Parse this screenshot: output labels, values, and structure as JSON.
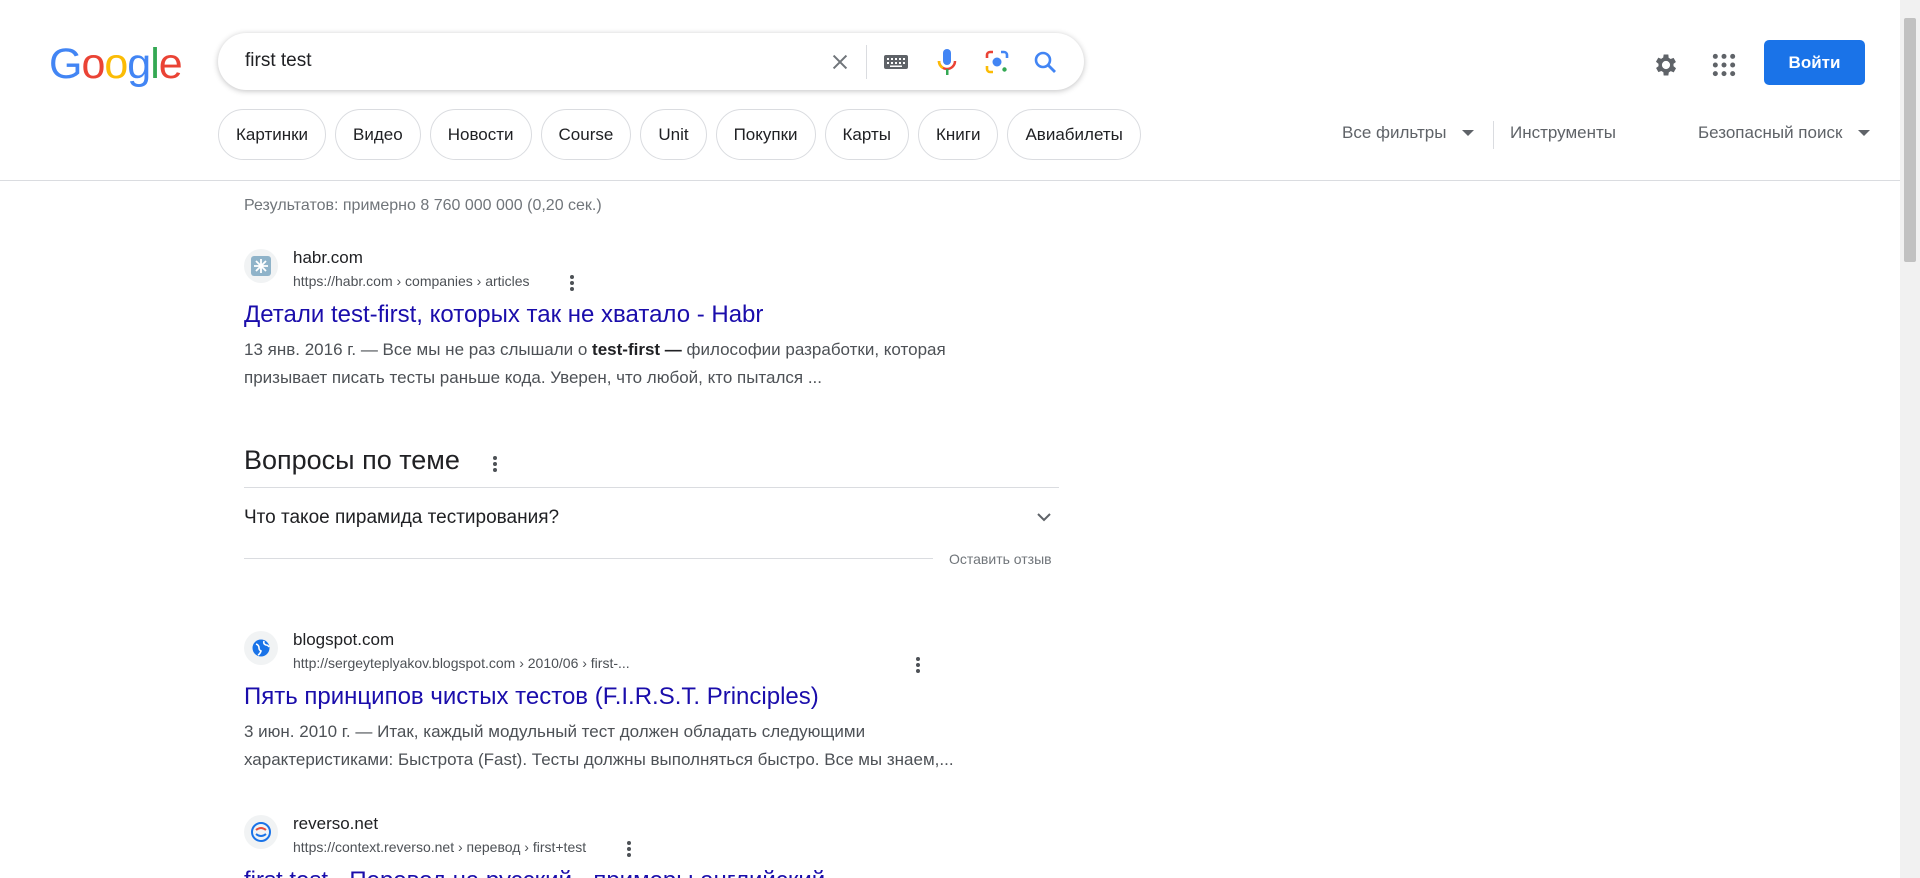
{
  "header": {
    "logo_letters": [
      {
        "ch": "G",
        "color": "#4285F4"
      },
      {
        "ch": "o",
        "color": "#EA4335"
      },
      {
        "ch": "o",
        "color": "#FBBC05"
      },
      {
        "ch": "g",
        "color": "#4285F4"
      },
      {
        "ch": "l",
        "color": "#34A853"
      },
      {
        "ch": "e",
        "color": "#EA4335"
      }
    ],
    "search_query": "first test",
    "login_label": "Войти",
    "icons": {
      "settings": "gear-icon",
      "apps": "apps-grid-icon"
    }
  },
  "chips": [
    "Картинки",
    "Видео",
    "Новости",
    "Course",
    "Unit",
    "Покупки",
    "Карты",
    "Книги",
    "Авиабилеты"
  ],
  "tools": {
    "all_filters": "Все фильтры",
    "tools": "Инструменты",
    "safe_search": "Безопасный поиск"
  },
  "stats": "Результатов: примерно 8 760 000 000 (0,20 сек.)",
  "results": [
    {
      "site": "habr.com",
      "url": "https://habr.com › companies › articles",
      "title": "Детали test-first, которых так не хватало - Habr",
      "date": "13 янв. 2016 г.",
      "snippet_pre": " — Все мы не раз слышали о ",
      "snippet_bold": "test-first —",
      "snippet_post": " философии разработки, которая призывает писать тесты раньше кода. Уверен, что любой, кто пытался ..."
    },
    {
      "site": "blogspot.com",
      "url": "http://sergeyteplyakov.blogspot.com › 2010/06 › first-...",
      "title": "Пять принципов чистых тестов (F.I.R.S.T. Principles)",
      "date": "3 июн. 2010 г.",
      "snippet": " — Итак, каждый модульный тест должен обладать следующими характеристиками: Быстрота (Fast). Тесты должны выполняться быстро. Все мы знаем,..."
    },
    {
      "site": "reverso.net",
      "url": "https://context.reverso.net › перевод › first+test",
      "title": "first test - Перевод на русский - примеры английский ..."
    }
  ],
  "paa": {
    "title": "Вопросы по теме",
    "question": "Что такое пирамида тестирования?",
    "feedback": "Оставить отзыв"
  },
  "colors": {
    "link": "#1a0dab",
    "accent": "#1a73e8"
  }
}
